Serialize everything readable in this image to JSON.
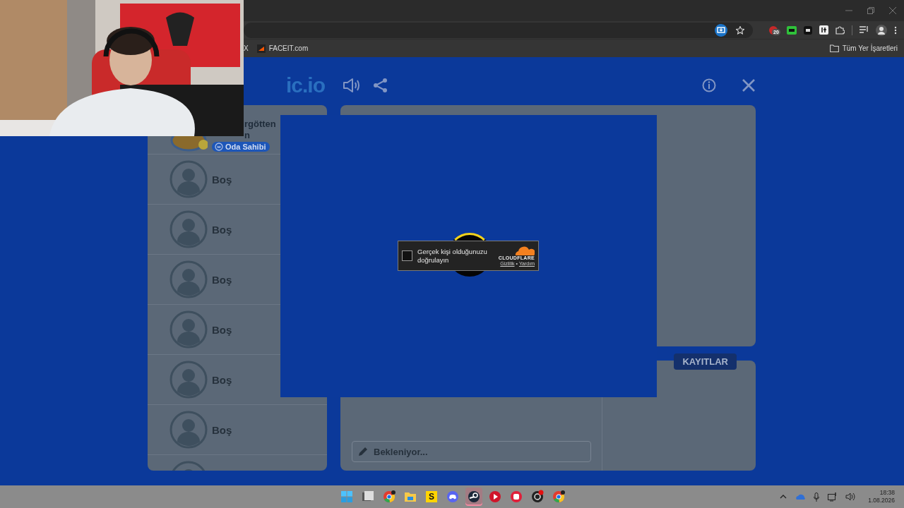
{
  "browser": {
    "bookmarks": [
      {
        "label": "X"
      },
      {
        "label": "FACEIT.com"
      }
    ],
    "all_bookmarks": "Tüm Yer İşaretleri",
    "extension_badge": "20"
  },
  "game": {
    "logo": "ic.io",
    "players": [
      {
        "kind": "player",
        "name_lines": [
          "rgötten",
          "n"
        ],
        "badge": "Oda Sahibi"
      },
      {
        "kind": "empty",
        "name": "Boş"
      },
      {
        "kind": "empty",
        "name": "Boş"
      },
      {
        "kind": "empty",
        "name": "Boş"
      },
      {
        "kind": "empty",
        "name": "Boş"
      },
      {
        "kind": "empty",
        "name": "Boş"
      },
      {
        "kind": "empty",
        "name": "Boş"
      },
      {
        "kind": "empty"
      }
    ],
    "logs_tab": "KAYITLAR",
    "chat": {
      "placeholder": "Bekleniyor..."
    }
  },
  "captcha": {
    "label": "Gerçek kişi olduğunuzu doğrulayın",
    "checked": false,
    "brand": "CLOUDFLARE",
    "links": [
      "Gizlilik",
      "Yardım"
    ],
    "separator": "•"
  },
  "taskbar": {
    "apps": [
      {
        "kind": "start",
        "selected": false
      },
      {
        "kind": "taskview",
        "selected": false
      },
      {
        "kind": "chrome",
        "selected": false
      },
      {
        "kind": "folder",
        "selected": false
      },
      {
        "kind": "letter",
        "label": "S",
        "selected": false
      },
      {
        "kind": "chat",
        "selected": false
      },
      {
        "kind": "steam",
        "selected": true
      },
      {
        "kind": "play",
        "selected": false
      },
      {
        "kind": "fist",
        "selected": false
      },
      {
        "kind": "record",
        "selected": false
      },
      {
        "kind": "chrome",
        "selected": false
      }
    ],
    "time": "18:38",
    "date": "1.08.2026"
  }
}
